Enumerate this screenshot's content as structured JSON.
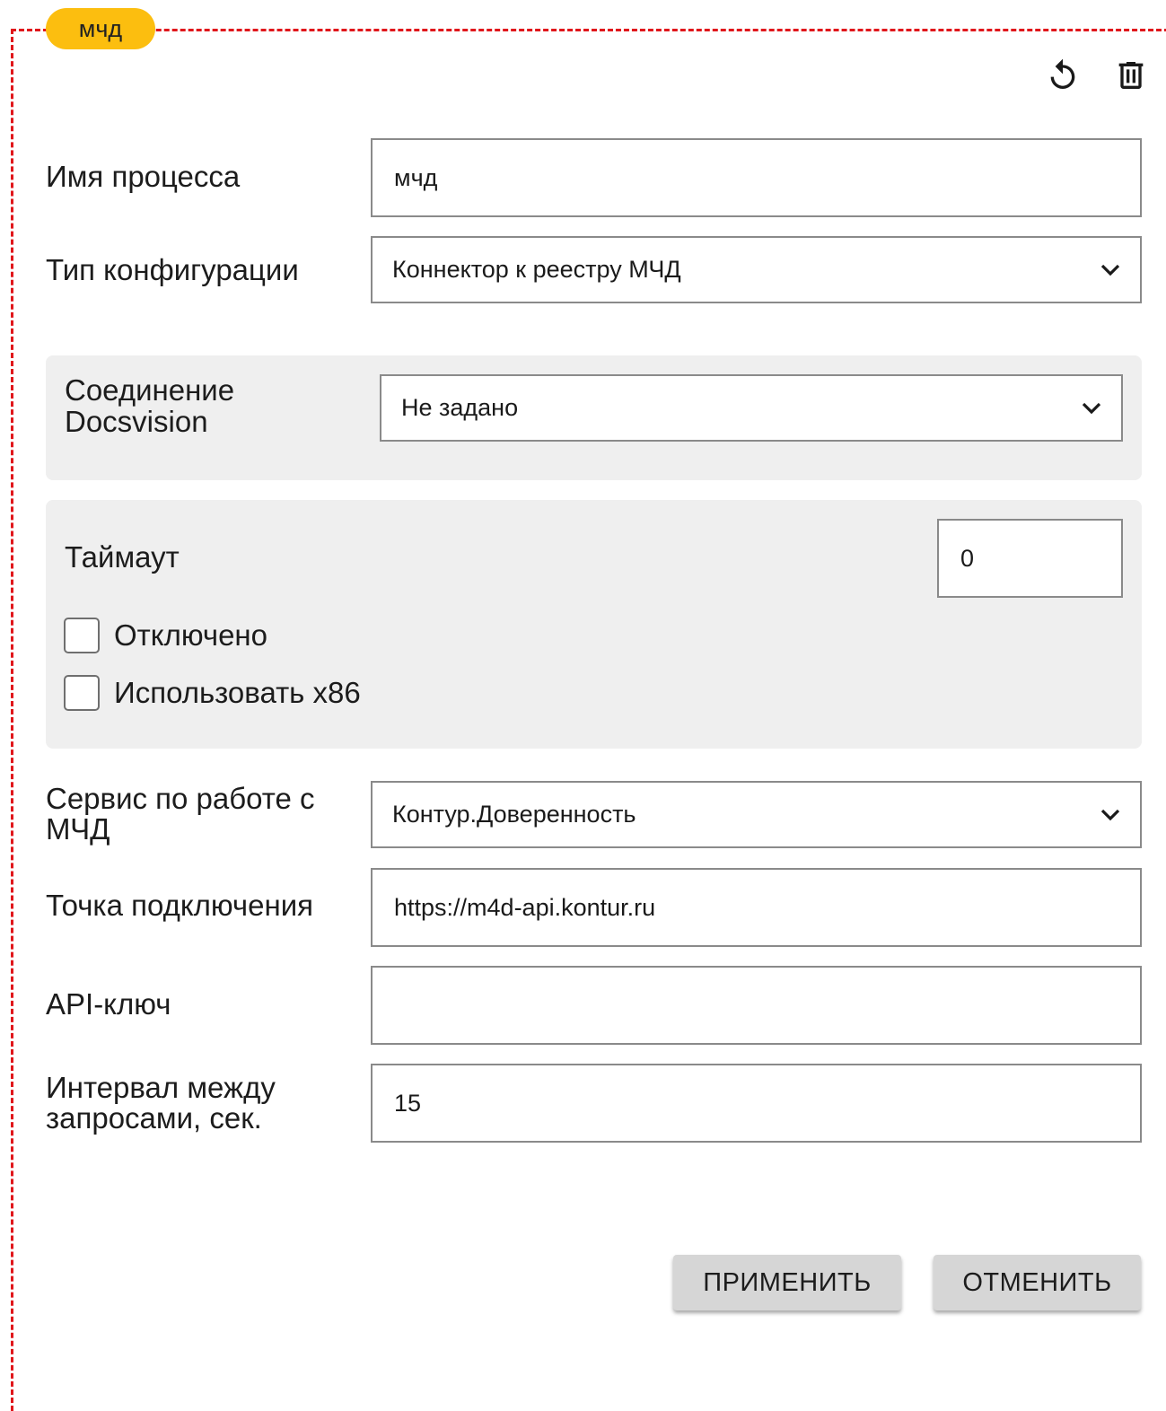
{
  "header": {
    "tag_label": "мчд",
    "reset_icon": "refresh-icon",
    "delete_icon": "trash-icon"
  },
  "form": {
    "process_name": {
      "label": "Имя процесса",
      "value": "мчд"
    },
    "config_type": {
      "label": "Тип конфигурации",
      "value": "Коннектор к реестру МЧД"
    },
    "docsvision_connection": {
      "label_line1": "Соединение",
      "label_line2": "Docsvision",
      "value": "Не задано"
    },
    "timeout": {
      "label": "Таймаут",
      "value": "0"
    },
    "disabled": {
      "label": "Отключено",
      "checked": false
    },
    "use_x86": {
      "label": "Использовать x86",
      "checked": false
    },
    "mcd_service": {
      "label_line1": "Сервис по работе с",
      "label_line2": "МЧД",
      "value": "Контур.Доверенность"
    },
    "endpoint": {
      "label": "Точка подключения",
      "value": "https://m4d-api.kontur.ru"
    },
    "api_key": {
      "label": "API-ключ",
      "value": ""
    },
    "interval": {
      "label_line1": "Интервал между",
      "label_line2": "запросами, сек.",
      "value": "15"
    }
  },
  "actions": {
    "apply_label": "ПРИМЕНИТЬ",
    "cancel_label": "ОТМЕНИТЬ"
  },
  "colors": {
    "frame_border": "#e0161b",
    "tag_background": "#fcbe0f",
    "panel_background": "#efefef",
    "button_background": "#d6d6d6"
  }
}
